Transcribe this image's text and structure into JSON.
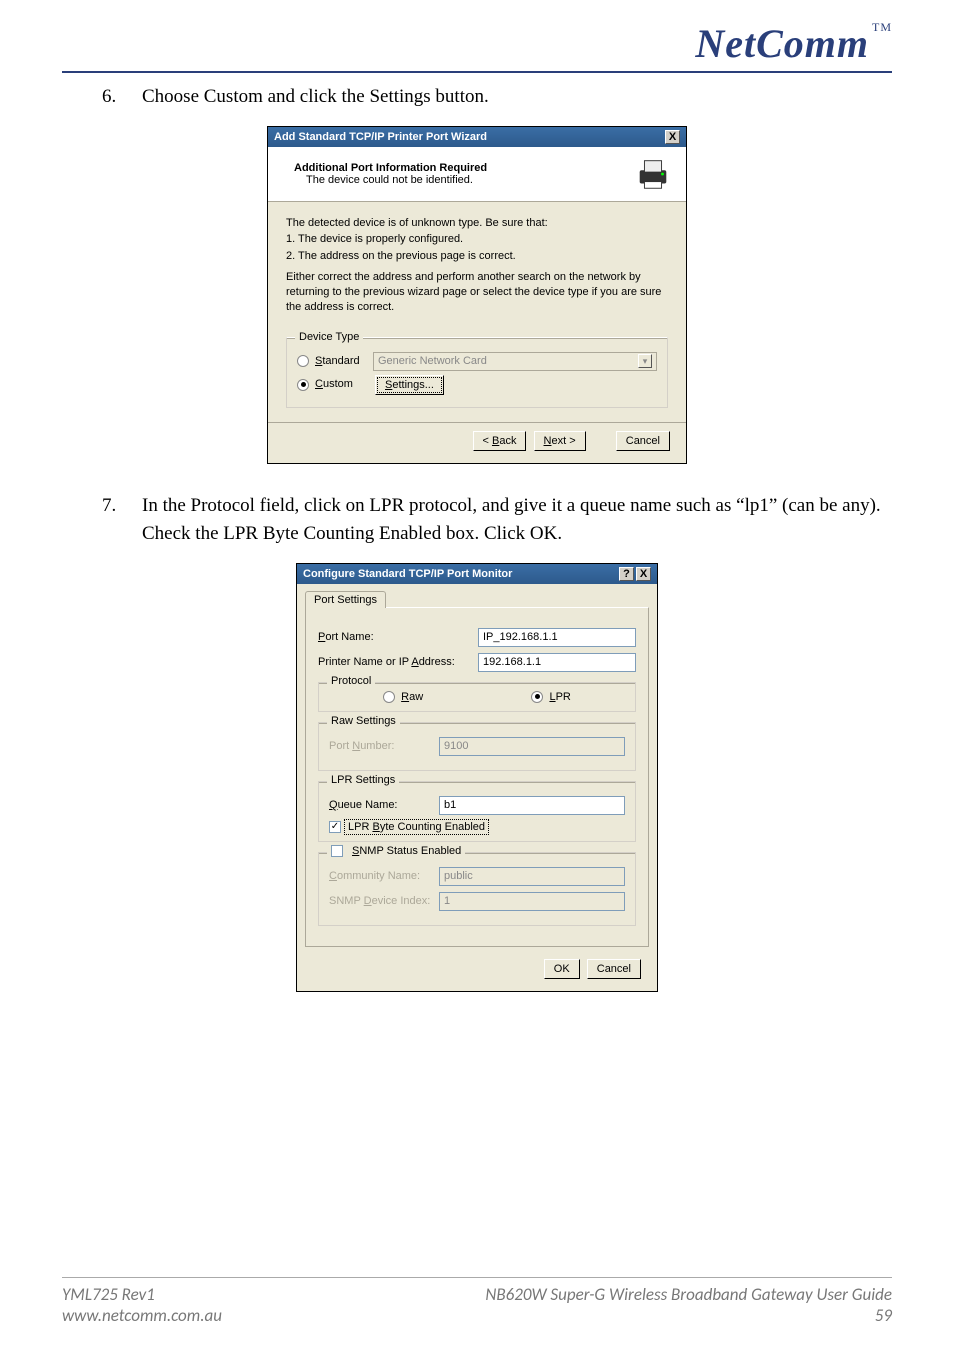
{
  "header": {
    "brand": "NetComm",
    "tm": "TM"
  },
  "steps": {
    "six": {
      "num": "6.",
      "text": "Choose Custom and click the Settings button."
    },
    "seven": {
      "num": "7.",
      "text": "In the Protocol field, click on LPR protocol, and give it a queue name such as “lp1” (can be any).  Check the LPR Byte Counting Enabled box. Click OK."
    }
  },
  "wizard": {
    "title": "Add Standard TCP/IP Printer Port Wizard",
    "sub_bold": "Additional Port Information Required",
    "sub_small": "The device could not be identified.",
    "body_l1": "The detected device is of unknown type.  Be sure that:",
    "body_l2": "1.  The device is properly configured.",
    "body_l3": "2.  The address on the previous page is correct.",
    "body_p2": "Either correct the address and perform another search on the network by returning to the previous wizard page or select the device type if you are sure the address is correct.",
    "group_legend": "Device Type",
    "radio_standard": "Standard",
    "combo_value": "Generic Network Card",
    "radio_custom": "Custom",
    "btn_settings": "Settings...",
    "btn_back": "< Back",
    "btn_next": "Next >",
    "btn_cancel": "Cancel",
    "close_x": "X"
  },
  "portmon": {
    "title": "Configure Standard TCP/IP Port Monitor",
    "help_q": "?",
    "close_x": "X",
    "tab": "Port Settings",
    "portname_label": "Port Name:",
    "portname_value": "IP_192.168.1.1",
    "addr_label": "Printer Name or IP Address:",
    "addr_value": "192.168.1.1",
    "protocol_legend": "Protocol",
    "radio_raw": "Raw",
    "radio_lpr": "LPR",
    "raw_legend": "Raw Settings",
    "raw_portnum_label": "Port Number:",
    "raw_portnum_value": "9100",
    "lpr_legend": "LPR Settings",
    "lpr_queue_label": "Queue Name:",
    "lpr_queue_value": "b1",
    "lpr_bytecount_label": "LPR Byte Counting Enabled",
    "snmp_legend": "SNMP Status Enabled",
    "snmp_comm_label": "Community Name:",
    "snmp_comm_value": "public",
    "snmp_idx_label": "SNMP Device Index:",
    "snmp_idx_value": "1",
    "btn_ok": "OK",
    "btn_cancel": "Cancel"
  },
  "footer": {
    "left_l1": "YML725 Rev1",
    "left_l2": "www.netcomm.com.au",
    "right_l1": "NB620W Super-G Wireless Broadband  Gateway User Guide",
    "right_l2": "59"
  }
}
